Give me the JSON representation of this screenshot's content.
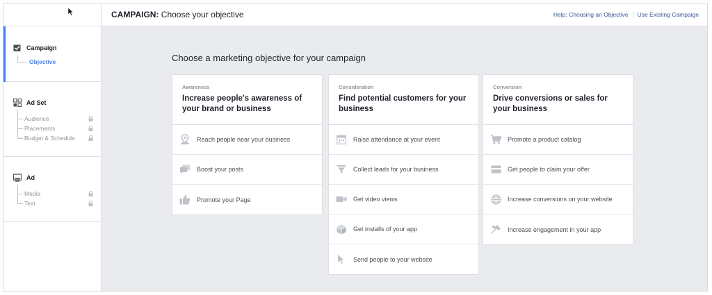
{
  "header": {
    "title_strong": "CAMPAIGN:",
    "title_rest": " Choose your objective",
    "help_link": "Help: Choosing an Objective",
    "existing_link": "Use Existing Campaign"
  },
  "sidebar": {
    "campaign": {
      "label": "Campaign",
      "sub": "Objective",
      "icon": "checkbox-icon"
    },
    "adset": {
      "label": "Ad Set",
      "icon": "grid-icon",
      "items": [
        "Audience",
        "Placements",
        "Budget & Schedule"
      ]
    },
    "ad": {
      "label": "Ad",
      "icon": "monitor-icon",
      "items": [
        "Media",
        "Text"
      ]
    }
  },
  "main": {
    "title": "Choose a marketing objective for your campaign",
    "columns": [
      {
        "kicker": "Awareness",
        "heading": "Increase people's awareness of your brand or business",
        "options": [
          {
            "label": "Reach people near your business",
            "icon": "location-pin-icon"
          },
          {
            "label": "Boost your posts",
            "icon": "speech-bubbles-icon"
          },
          {
            "label": "Promote your Page",
            "icon": "thumbs-up-icon"
          }
        ]
      },
      {
        "kicker": "Consideration",
        "heading": "Find potential customers for your business",
        "options": [
          {
            "label": "Raise attendance at your event",
            "icon": "calendar-icon"
          },
          {
            "label": "Collect leads for your business",
            "icon": "funnel-icon"
          },
          {
            "label": "Get video views",
            "icon": "video-camera-icon"
          },
          {
            "label": "Get installs of your app",
            "icon": "box-icon"
          },
          {
            "label": "Send people to your website",
            "icon": "cursor-icon"
          }
        ]
      },
      {
        "kicker": "Conversion",
        "heading": "Drive conversions or sales for your business",
        "options": [
          {
            "label": "Promote a product catalog",
            "icon": "shopping-cart-icon"
          },
          {
            "label": "Get people to claim your offer",
            "icon": "offer-card-icon"
          },
          {
            "label": "Increase conversions on your website",
            "icon": "globe-icon"
          },
          {
            "label": "Increase engagement in your app",
            "icon": "app-engagement-icon"
          }
        ]
      }
    ]
  },
  "colors": {
    "accent": "#4080ff",
    "link": "#365899",
    "icon": "#bec2c9",
    "background": "#e9ebee"
  }
}
